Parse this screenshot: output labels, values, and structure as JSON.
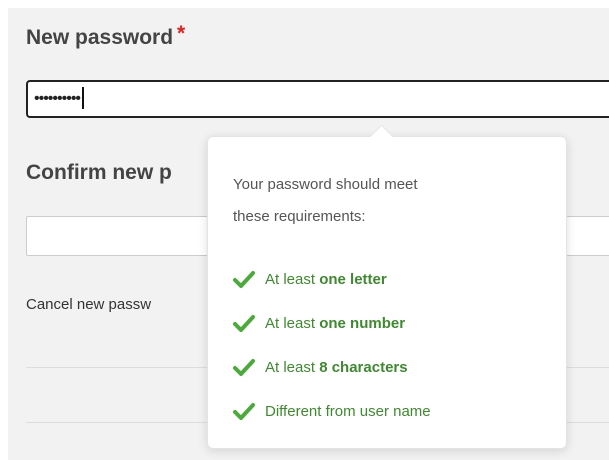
{
  "form": {
    "new_password_label": "New password",
    "required_marker": "*",
    "password_value": "••••••••••",
    "confirm_label": "Confirm new p",
    "confirm_value": "",
    "cancel_link": "Cancel new passw"
  },
  "popover": {
    "intro_line1": "Your password should meet",
    "intro_line2": "these requirements:",
    "requirements": [
      {
        "prefix": "At least ",
        "strong": "one letter",
        "met": true
      },
      {
        "prefix": "At least ",
        "strong": "one number",
        "met": true
      },
      {
        "prefix": "At least ",
        "strong": "8 characters",
        "met": true
      },
      {
        "prefix": "Different from user name",
        "strong": "",
        "met": true
      }
    ],
    "check_icon": "check-icon",
    "check_color": "#4aaa3a"
  },
  "colors": {
    "required": "#e02020",
    "requirement_text": "#3e8a2e",
    "panel_bg": "#f2f2f2"
  }
}
